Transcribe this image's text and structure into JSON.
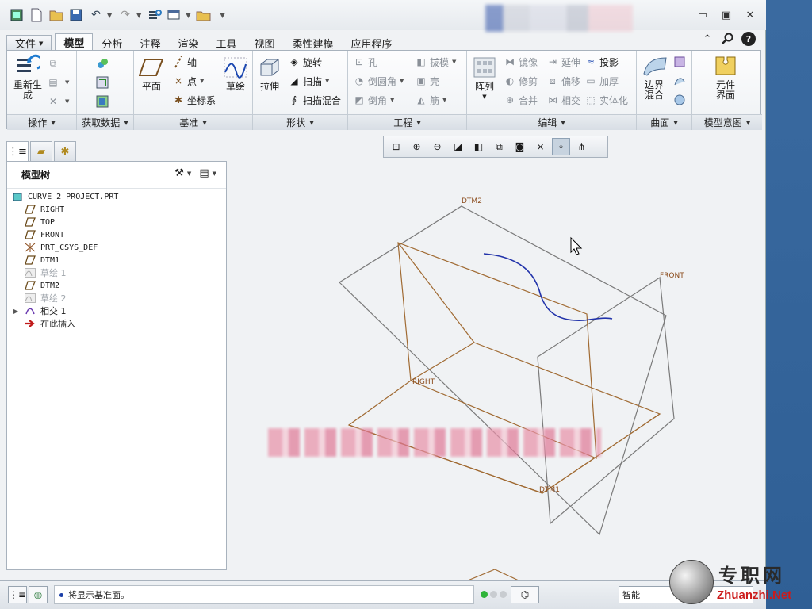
{
  "window": {
    "minimize": "▭",
    "restore": "▣",
    "close": "✕"
  },
  "tabs": [
    "文件",
    "模型",
    "分析",
    "注释",
    "渲染",
    "工具",
    "视图",
    "柔性建模",
    "应用程序"
  ],
  "ribbon": {
    "ops": {
      "label": "操作",
      "regenerate": "重新生\n成"
    },
    "getdata": {
      "label": "获取数据"
    },
    "datum": {
      "label": "基准",
      "plane": "平面",
      "axis": "轴",
      "point": "点",
      "csys": "坐标系",
      "sketch": "草绘"
    },
    "shapes": {
      "label": "形状",
      "extrude": "拉伸",
      "revolve": "旋转",
      "sweep": "扫描",
      "swept_blend": "扫描混合"
    },
    "engineering": {
      "label": "工程",
      "hole": "孔",
      "round": "倒圆角",
      "chamfer": "倒角",
      "draft": "拔模",
      "shell": "壳",
      "rib": "筋"
    },
    "editing": {
      "label": "编辑",
      "pattern": "阵列",
      "mirror": "镜像",
      "trim": "修剪",
      "merge": "合并",
      "extend": "延伸",
      "offset": "偏移",
      "intersect": "相交",
      "project": "投影",
      "thicken": "加厚",
      "solidify": "实体化"
    },
    "surfaces": {
      "label": "曲面",
      "boundary_blend": "边界\n混合"
    },
    "intent": {
      "label": "模型意图",
      "component_interface": "元件\n界面"
    }
  },
  "tree": {
    "title": "模型树",
    "items": [
      {
        "label": "CURVE_2_PROJECT.PRT",
        "icon": "part-icon",
        "state": "normal"
      },
      {
        "label": "RIGHT",
        "icon": "datum-plane-icon",
        "state": "normal"
      },
      {
        "label": "TOP",
        "icon": "datum-plane-icon",
        "state": "normal"
      },
      {
        "label": "FRONT",
        "icon": "datum-plane-icon",
        "state": "normal"
      },
      {
        "label": "PRT_CSYS_DEF",
        "icon": "csys-icon",
        "state": "normal"
      },
      {
        "label": "DTM1",
        "icon": "datum-plane-icon",
        "state": "normal"
      },
      {
        "label": "草绘 1",
        "icon": "sketch-icon",
        "state": "disabled"
      },
      {
        "label": "DTM2",
        "icon": "datum-plane-icon",
        "state": "normal"
      },
      {
        "label": "草绘 2",
        "icon": "sketch-icon",
        "state": "disabled"
      },
      {
        "label": "相交 1",
        "icon": "intersect-icon",
        "state": "expandable"
      },
      {
        "label": "在此插入",
        "icon": "insert-here-icon",
        "state": "normal"
      }
    ]
  },
  "viewport": {
    "labels": {
      "dtm2": "DTM2",
      "front": "FRONT",
      "right": "RIGHT",
      "dtm1": "DTM1"
    }
  },
  "status": {
    "message": "将显示基准面。",
    "filter": "智能"
  },
  "watermark": {
    "cn": "专职网",
    "en": "Zhuanzhi.Net"
  },
  "colors": {
    "brown": "#a06a32",
    "gray": "#7a7a7a",
    "curve": "#2233aa"
  }
}
